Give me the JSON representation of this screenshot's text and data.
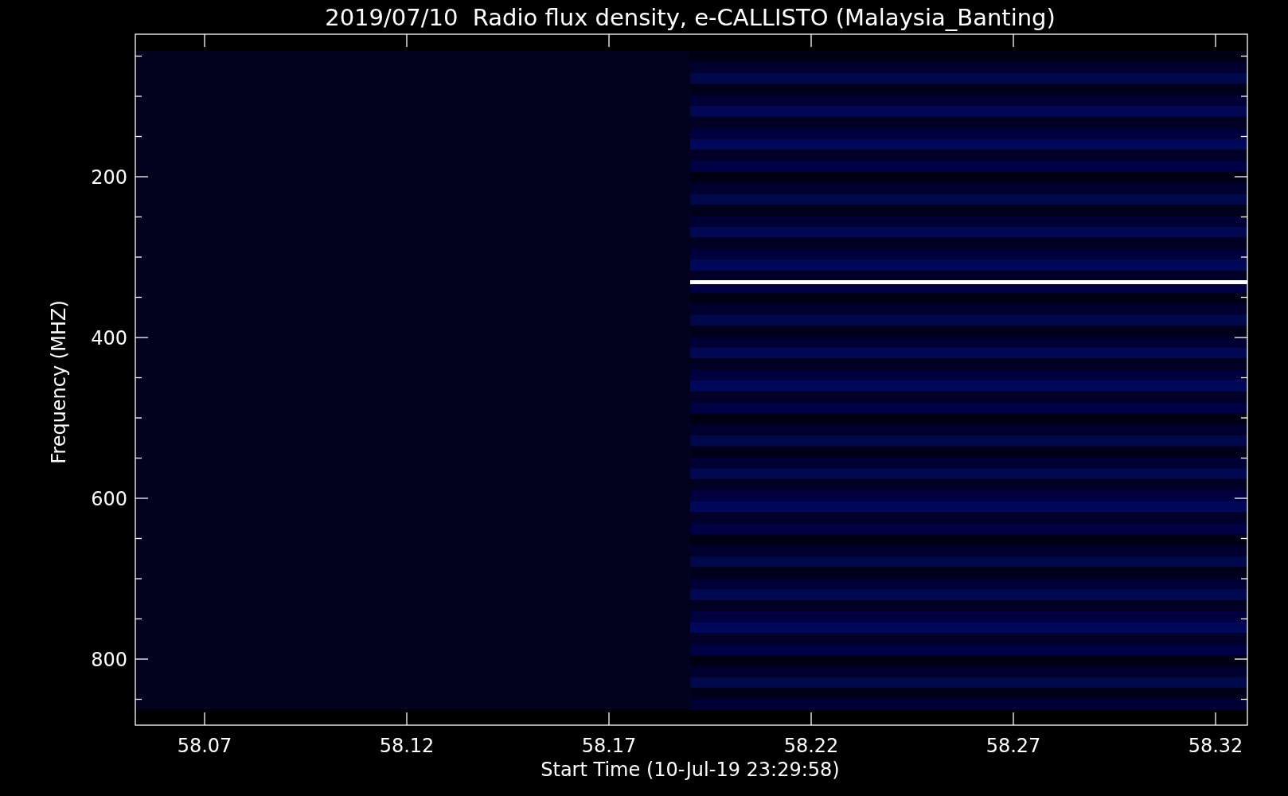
{
  "plot": {
    "title": "2019/07/10  Radio flux density, e-CALLISTO (Malaysia_Banting)",
    "xlabel": "Start Time (10-Jul-19 23:29:58)",
    "ylabel": "Frequency (MHZ)",
    "xtick_labels": [
      "58.07",
      "58.12",
      "58.17",
      "58.22",
      "58.27",
      "58.32"
    ],
    "ytick_labels": [
      "200",
      "400",
      "600",
      "800"
    ]
  }
}
